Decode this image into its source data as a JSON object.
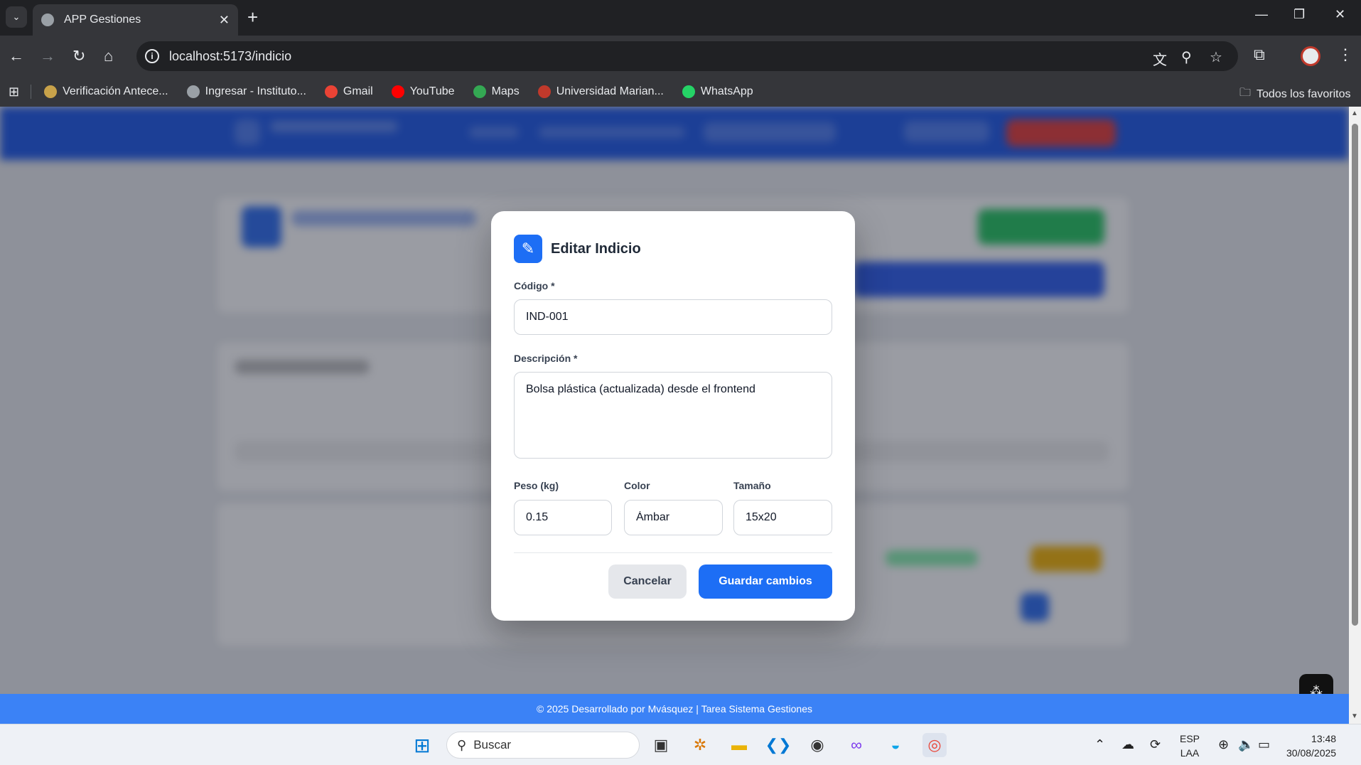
{
  "browser": {
    "tab_title": "APP Gestiones",
    "url": "localhost:5173/indicio",
    "bookmarks": [
      {
        "label": "Verificación Antece...",
        "color": "#c8a24a"
      },
      {
        "label": "Ingresar - Instituto...",
        "color": "#9aa0a6"
      },
      {
        "label": "Gmail",
        "color": "#ea4335"
      },
      {
        "label": "YouTube",
        "color": "#ff0000"
      },
      {
        "label": "Maps",
        "color": "#34a853"
      },
      {
        "label": "Universidad Marian...",
        "color": "#c0392b"
      },
      {
        "label": "WhatsApp",
        "color": "#25d366"
      }
    ],
    "all_bookmarks_label": "Todos los favoritos"
  },
  "modal": {
    "title": "Editar Indicio",
    "codigo_label": "Código *",
    "codigo_value": "IND-001",
    "descripcion_label": "Descripción *",
    "descripcion_value": "Bolsa plástica (actualizada) desde el frontend",
    "peso_label": "Peso (kg)",
    "peso_value": "0.15",
    "color_label": "Color",
    "color_value": "Ámbar",
    "tamano_label": "Tamaño",
    "tamano_value": "15x20",
    "cancel_label": "Cancelar",
    "save_label": "Guardar cambios"
  },
  "footer": {
    "text": "© 2025 Desarrollado por Mvásquez | Tarea Sistema Gestiones"
  },
  "taskbar": {
    "search_placeholder": "Buscar",
    "lang_top": "ESP",
    "lang_bottom": "LAA",
    "time": "13:48",
    "date": "30/08/2025"
  },
  "colors": {
    "primary": "#1d6ef5",
    "header": "#1a56e8",
    "footer": "#3b82f6"
  }
}
